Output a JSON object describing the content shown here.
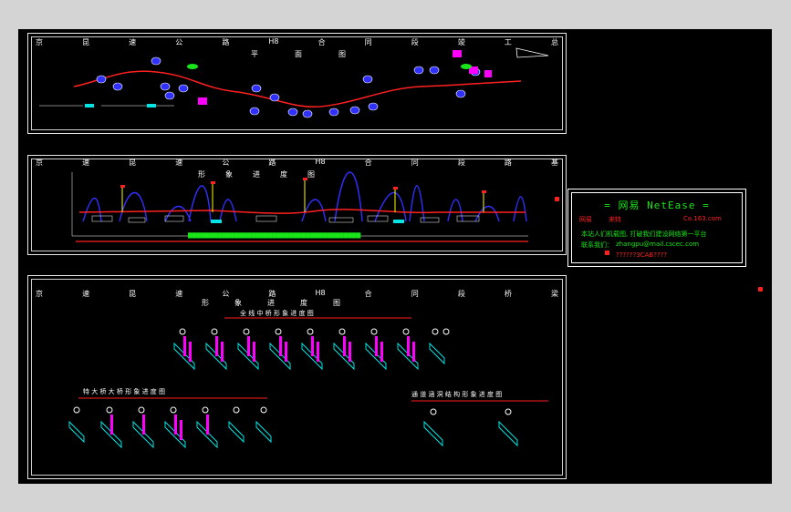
{
  "sheet1": {
    "title_chars": [
      "京",
      "昆",
      "速",
      "公",
      "路",
      "H8",
      "合",
      "同",
      "段",
      "竣",
      "工",
      "总"
    ],
    "subtitle_chars": [
      "平",
      "面",
      "图"
    ]
  },
  "sheet2": {
    "title_chars": [
      "京",
      "速",
      "昆",
      "速",
      "公",
      "路",
      "H8",
      "合",
      "同",
      "段",
      "路",
      "基"
    ],
    "subtitle_chars": [
      "形",
      "象",
      "进",
      "度",
      "图"
    ]
  },
  "sheet3": {
    "title_chars": [
      "京",
      "速",
      "昆",
      "速",
      "公",
      "路",
      "H8",
      "合",
      "同",
      "段",
      "桥",
      "梁"
    ],
    "subtitle_chars": [
      "形",
      "象",
      "进",
      "度",
      "图"
    ],
    "group1_label": "全 线 中 桥 形 象 进 度 图",
    "group2_label": "特 大 桥 大 桥 形 象 进 度 图",
    "group3_label": "通 道 涵 洞 结 构 形 象 进 度 图"
  },
  "netease": {
    "title": "=  网易 NetEase  =",
    "brand_left": "网易",
    "brand_mid": "来特",
    "brand_url": "Co.163.com",
    "line1": "本站人们机载图, 打破我们建设网络第一平台",
    "line2_label": "联系我们：",
    "line2_value": "zhangpu@mail.cscec.com",
    "line3": "??????3CAB????"
  },
  "colors": {
    "canvas": "#000000",
    "background": "#d4d4d4",
    "road": "#ff2020",
    "accent_green": "#19e619",
    "accent_magenta": "#ff00ff",
    "accent_blue": "#3030ff",
    "accent_cyan": "#00e5e5"
  }
}
